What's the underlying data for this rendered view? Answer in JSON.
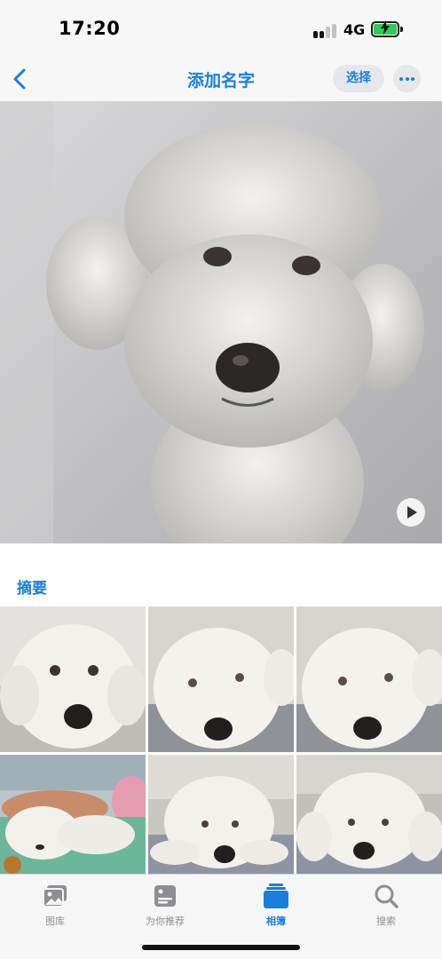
{
  "status_bar": {
    "time": "17:20",
    "network": "4G",
    "battery_state": "charging",
    "battery_color": "#31c759"
  },
  "nav": {
    "back_icon": "chevron-left-icon",
    "title": "添加名字",
    "select_label": "选择",
    "more_icon": "ellipsis-icon"
  },
  "hero": {
    "play_icon": "play-icon"
  },
  "summary": {
    "title": "摘要"
  },
  "tab_bar": {
    "tabs": [
      {
        "label": "图库",
        "icon": "photo-library-icon",
        "active": false
      },
      {
        "label": "为你推荐",
        "icon": "for-you-icon",
        "active": false
      },
      {
        "label": "相簿",
        "icon": "albums-icon",
        "active": true
      },
      {
        "label": "搜索",
        "icon": "search-icon",
        "active": false
      }
    ]
  },
  "colors": {
    "accent": "#1a7de0",
    "bar_background": "#f7f7f8",
    "inactive_tab": "#8e8e93"
  }
}
